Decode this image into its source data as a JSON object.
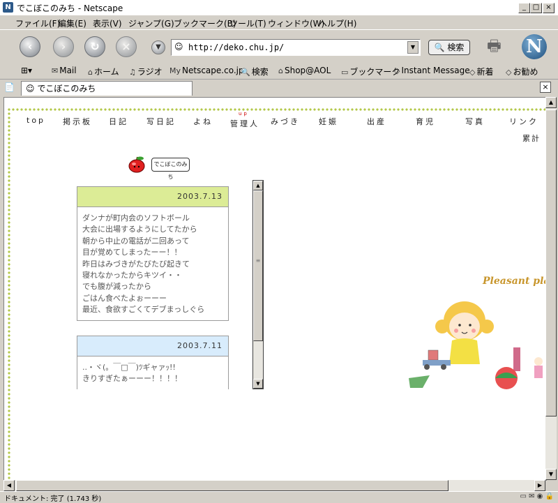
{
  "window": {
    "title": "でこぼこのみち - Netscape",
    "app_icon": "N"
  },
  "menu": [
    "ファイル(F)",
    "編集(E)",
    "表示(V)",
    "ジャンプ(G)",
    "ブックマーク(B)",
    "ツール(T)",
    "ウィンドウ(W)",
    "ヘルプ(H)"
  ],
  "nav": {
    "url": "http://deko.chu.jp/",
    "search_label": "検索"
  },
  "personal_toolbar": {
    "items": [
      "Mail",
      "ホーム",
      "ラジオ",
      "Netscape.co.jp",
      "検索",
      "Shop@AOL",
      "ブックマーク",
      "Instant Message",
      "新着",
      "お勧め"
    ],
    "my_badge": "My"
  },
  "tab": {
    "title": "でこぼこのみち"
  },
  "page": {
    "nav_links": [
      "top",
      "掲示板",
      "日記",
      "写日記",
      "よね",
      "管理人",
      "みづき",
      "妊娠",
      "出産",
      "育児",
      "写真",
      "リンク"
    ],
    "admin_badge": "up",
    "counter_label": "累計",
    "logo_text": "でこぼこのみち",
    "diary": [
      {
        "date": "2003.7.13",
        "color": "#dcec96",
        "text": "ダンナが町内会のソフトボール\n大会に出場するようにしてたから\n朝から中止の電話が二回あって\n目が覚めてしまったーー！！\n昨日はみづきがたびたび起きて\n寝れなかったからキツイ・・\nでも腹が減ったから\nごはん食べたよぉーーー\n最近、食欲すごくてデブまっしぐら"
      },
      {
        "date": "2003.7.11",
        "color": "#d8ecfc",
        "text": "..・ヾ(。￣□￣)ﾂギャァｯ!!\nきりすぎたぁーーー！！！！"
      }
    ],
    "illustration_caption": "Pleasant play"
  },
  "status": {
    "text": "ドキュメント: 完了 (1.743 秒)"
  },
  "colors": {
    "accent_border": "#b4c84a",
    "entry1_head": "#dcec96",
    "entry2_head": "#d8ecfc"
  }
}
